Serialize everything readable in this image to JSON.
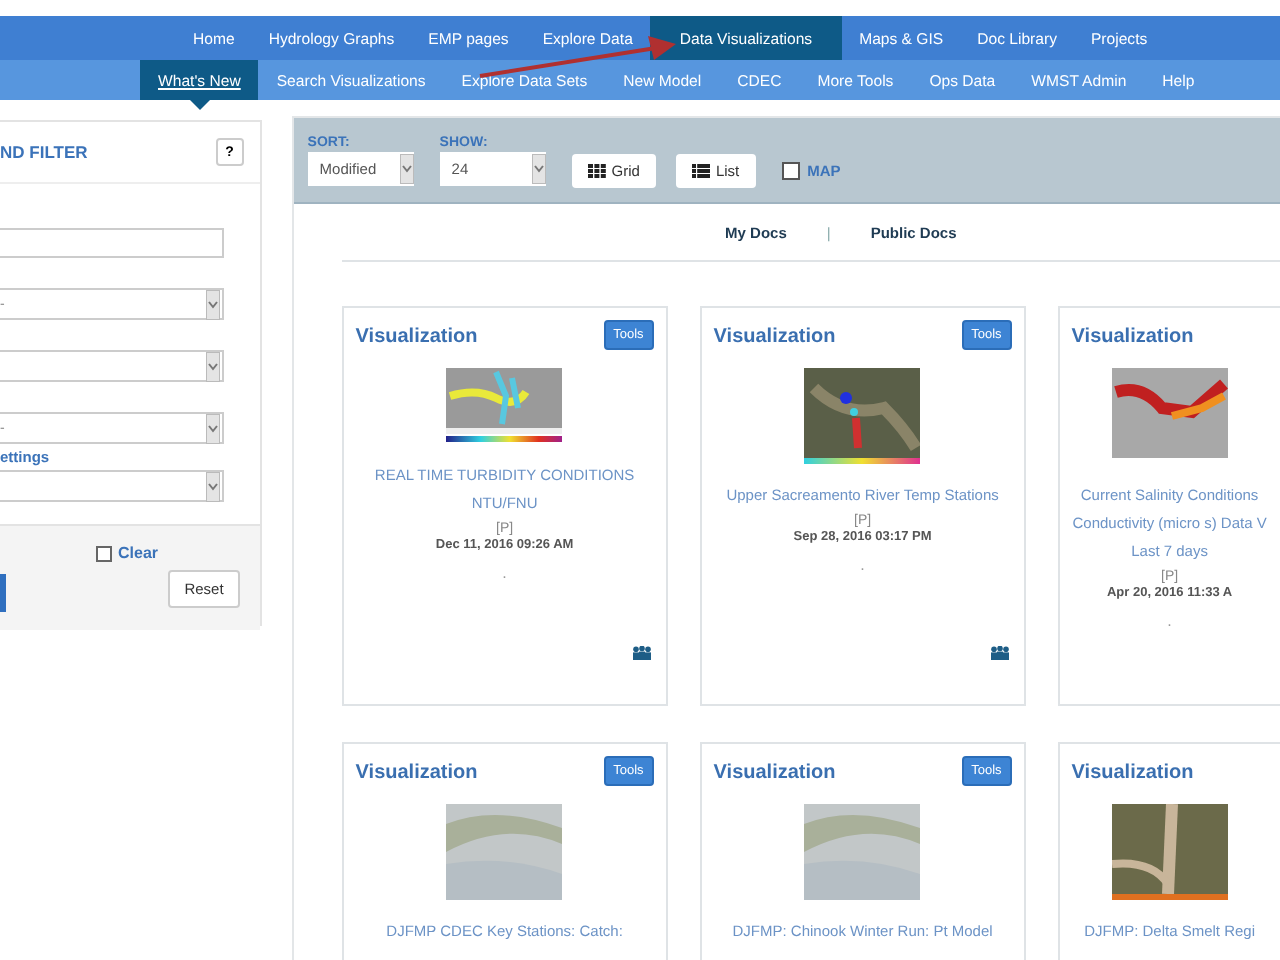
{
  "nav": {
    "items": [
      {
        "label": "Home",
        "selected": false
      },
      {
        "label": "Hydrology Graphs",
        "selected": false
      },
      {
        "label": "EMP pages",
        "selected": false
      },
      {
        "label": "Explore Data",
        "selected": false
      },
      {
        "label": "Data Visualizations",
        "selected": true
      },
      {
        "label": "Maps & GIS",
        "selected": false
      },
      {
        "label": "Doc Library",
        "selected": false
      },
      {
        "label": "Projects",
        "selected": false
      }
    ]
  },
  "subnav": {
    "items": [
      {
        "label": "What's New",
        "selected": true
      },
      {
        "label": "Search Visualizations",
        "selected": false
      },
      {
        "label": "Explore Data Sets",
        "selected": false
      },
      {
        "label": "New Model",
        "selected": false
      },
      {
        "label": "CDEC",
        "selected": false
      },
      {
        "label": "More Tools",
        "selected": false
      },
      {
        "label": "Ops Data",
        "selected": false
      },
      {
        "label": "WMST Admin",
        "selected": false
      },
      {
        "label": "Help",
        "selected": false
      }
    ]
  },
  "filter": {
    "title": "ND FILTER",
    "help": "?",
    "fields": [
      {
        "kind": "text"
      },
      {
        "kind": "select",
        "value": "-"
      },
      {
        "kind": "select"
      },
      {
        "kind": "select",
        "value": "-"
      },
      {
        "kind": "link",
        "label": "ettings"
      },
      {
        "kind": "select"
      }
    ],
    "clear": {
      "label": "Clear",
      "checked": false
    },
    "reset": "Reset"
  },
  "toolbar": {
    "sort_label": "SORT:",
    "sort_value": "Modified",
    "show_label": "SHOW:",
    "show_value": "24",
    "views": [
      {
        "label": "Grid",
        "kind": "grid"
      },
      {
        "label": "List",
        "kind": "list"
      }
    ],
    "map": {
      "label": "MAP",
      "checked": false
    }
  },
  "doc_tabs": {
    "items": [
      {
        "label": "My Docs"
      },
      {
        "label": "Public Docs"
      }
    ],
    "separator": "|"
  },
  "cards": [
    {
      "type": "Visualization",
      "tools": "Tools",
      "kind": "heatmap",
      "title_lines": [
        "REAL TIME TURBIDITY CONDITIONS",
        "NTU/FNU"
      ],
      "privacy": "[P]",
      "date": "Dec 11, 2016 09:26 AM",
      "note": ".",
      "shared": true
    },
    {
      "type": "Visualization",
      "tools": "Tools",
      "kind": "satellite",
      "title_lines": [
        "Upper Sacreamento River Temp Stations"
      ],
      "privacy": "[P]",
      "date": "Sep 28, 2016 03:17 PM",
      "note": ".",
      "shared": true
    },
    {
      "type": "Visualization",
      "kind": "salinity",
      "title_lines": [
        "Current Salinity Conditions",
        "Conductivity (micro s) Data V",
        "Last 7 days"
      ],
      "privacy": "[P]",
      "date": "Apr 20, 2016 11:33 A",
      "note": "."
    },
    {
      "type": "Visualization",
      "tools": "Tools",
      "kind": "placeholder",
      "title_lines": [
        "DJFMP CDEC Key Stations: Catch:"
      ]
    },
    {
      "type": "Visualization",
      "tools": "Tools",
      "kind": "placeholder",
      "title_lines": [
        "DJFMP: Chinook Winter Run: Pt Model"
      ]
    },
    {
      "type": "Visualization",
      "kind": "aerial",
      "title_lines": [
        "DJFMP: Delta Smelt Regi"
      ]
    }
  ]
}
